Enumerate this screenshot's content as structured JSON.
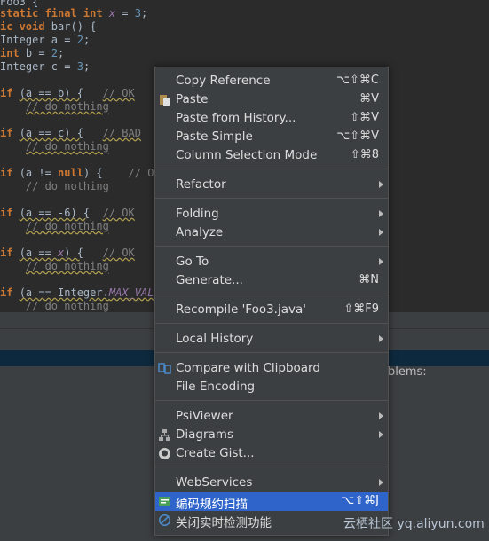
{
  "editor": {
    "lines": [
      {
        "code": "Foo3 {"
      },
      {
        "code": "static final int x = 3;"
      },
      {
        "code": "ic void bar() {"
      },
      {
        "code": "Integer a = 2;"
      },
      {
        "code": "int b = 2;"
      },
      {
        "code": "Integer c = 3;"
      },
      {
        "code": "if (a == b) {   // OK"
      },
      {
        "code": "    // do nothing"
      },
      {
        "code": "if (a == c) {   // BAD"
      },
      {
        "code": "    // do nothing"
      },
      {
        "code": "if (a != null) {    // OK"
      },
      {
        "code": "    // do nothing"
      },
      {
        "code": "if (a == -6) {  // OK"
      },
      {
        "code": "    // do nothing"
      },
      {
        "code": "if (a == x) {   // OK"
      },
      {
        "code": "    // do nothing"
      },
      {
        "code": "if (a == Integer.MAX_VALUE"
      },
      {
        "code": "    // do nothing"
      }
    ]
  },
  "bottom_panel": {
    "problems_label": "blems:"
  },
  "menu": {
    "copy_reference": {
      "label": "Copy Reference",
      "shortcut": "⌥⇧⌘C"
    },
    "paste": {
      "label": "Paste",
      "shortcut": "⌘V"
    },
    "paste_from_history": {
      "label": "Paste from History...",
      "shortcut": "⇧⌘V"
    },
    "paste_simple": {
      "label": "Paste Simple",
      "shortcut": "⌥⇧⌘V"
    },
    "column_selection_mode": {
      "label": "Column Selection Mode",
      "shortcut": "⇧⌘8"
    },
    "refactor": {
      "label": "Refactor"
    },
    "folding": {
      "label": "Folding"
    },
    "analyze": {
      "label": "Analyze"
    },
    "go_to": {
      "label": "Go To"
    },
    "generate": {
      "label": "Generate...",
      "shortcut": "⌘N"
    },
    "recompile": {
      "label": "Recompile 'Foo3.java'",
      "shortcut": "⇧⌘F9"
    },
    "local_history": {
      "label": "Local History"
    },
    "compare_clipboard": {
      "label": "Compare with Clipboard"
    },
    "file_encoding": {
      "label": "File Encoding"
    },
    "psiviewer": {
      "label": "PsiViewer"
    },
    "diagrams": {
      "label": "Diagrams"
    },
    "create_gist": {
      "label": "Create Gist..."
    },
    "webservices": {
      "label": "WebServices"
    },
    "code_scan": {
      "label": "编码规约扫描",
      "shortcut": "⌥⇧⌘J"
    },
    "close_realtime": {
      "label": "关闭实时检测功能"
    }
  },
  "watermark": {
    "text": "云栖社区 yq.aliyun.com"
  },
  "colors": {
    "menu_bg": "#3c3f41",
    "selection": "#2f65ca",
    "editor_bg": "#2b2b2b"
  }
}
